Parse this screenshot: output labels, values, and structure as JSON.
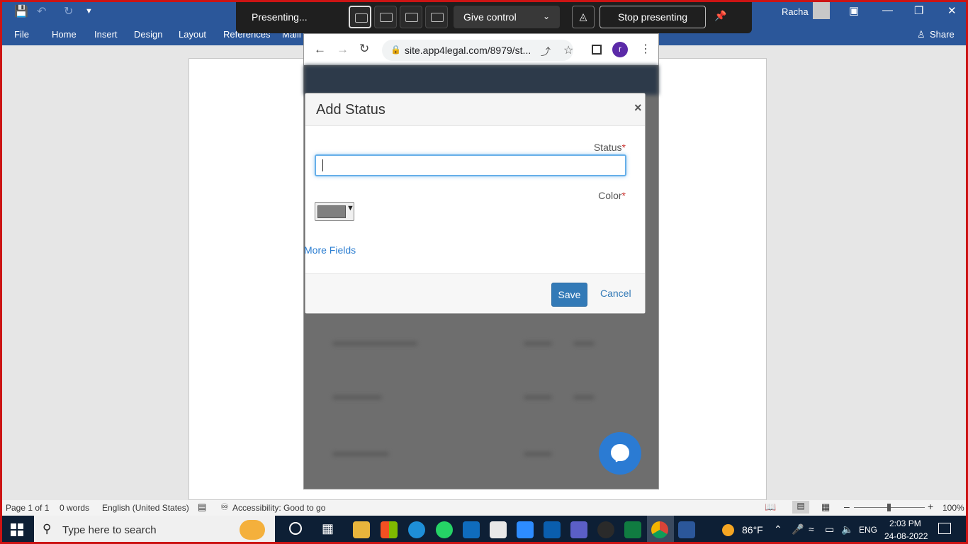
{
  "word": {
    "ribbon_tabs": [
      "File",
      "Home",
      "Insert",
      "Design",
      "Layout",
      "References",
      "Maili"
    ],
    "user_name": "Racha",
    "share_label": "Share",
    "status": {
      "page": "Page 1 of 1",
      "words": "0 words",
      "language": "English (United States)",
      "accessibility": "Accessibility: Good to go",
      "zoom": "100%"
    }
  },
  "presenting": {
    "status_text": "Presenting...",
    "give_control_label": "Give control",
    "stop_label": "Stop presenting"
  },
  "browser": {
    "url": "site.app4legal.com/8979/st...",
    "profile_initial": "r"
  },
  "modal": {
    "title": "Add Status",
    "close_glyph": "×",
    "status_label": "Status",
    "color_label": "Color",
    "required_mark": "*",
    "color_value": "#808080",
    "more_fields_label": "More Fields",
    "save_label": "Save",
    "cancel_label": "Cancel"
  },
  "taskbar": {
    "search_placeholder": "Type here to search",
    "weather": "86°F",
    "lang": "ENG",
    "time": "2:03 PM",
    "date": "24-08-2022"
  }
}
